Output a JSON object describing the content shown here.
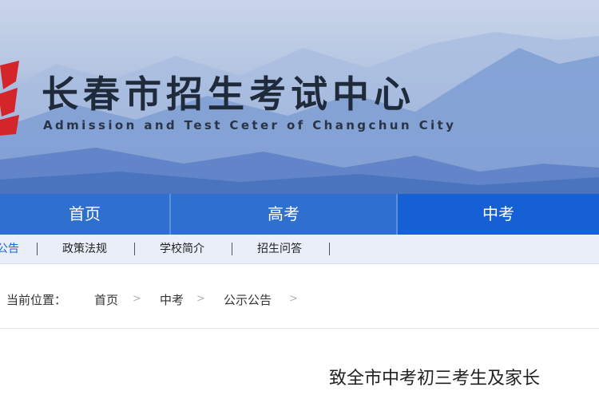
{
  "header": {
    "title": "长春市招生考试中心",
    "subtitle": "Admission and Test Ceter of Changchun City",
    "logo_icon": "ccks-logo-icon"
  },
  "main_nav": {
    "tabs": [
      {
        "label": "首页"
      },
      {
        "label": "高考"
      },
      {
        "label": "中考"
      }
    ],
    "active_index": 2
  },
  "sub_nav": {
    "items": [
      {
        "label": "公告"
      },
      {
        "label": "政策法规"
      },
      {
        "label": "学校简介"
      },
      {
        "label": "招生问答"
      }
    ]
  },
  "breadcrumb": {
    "label": "当前位置：",
    "items": [
      {
        "label": "首页"
      },
      {
        "label": "中考"
      },
      {
        "label": "公示公告"
      }
    ],
    "separator": ">"
  },
  "article": {
    "title": "致全市中考初三考生及家长"
  },
  "colors": {
    "nav_blue": "#2f6fd0",
    "nav_active": "#1560d4",
    "logo_red": "#d4262a"
  }
}
